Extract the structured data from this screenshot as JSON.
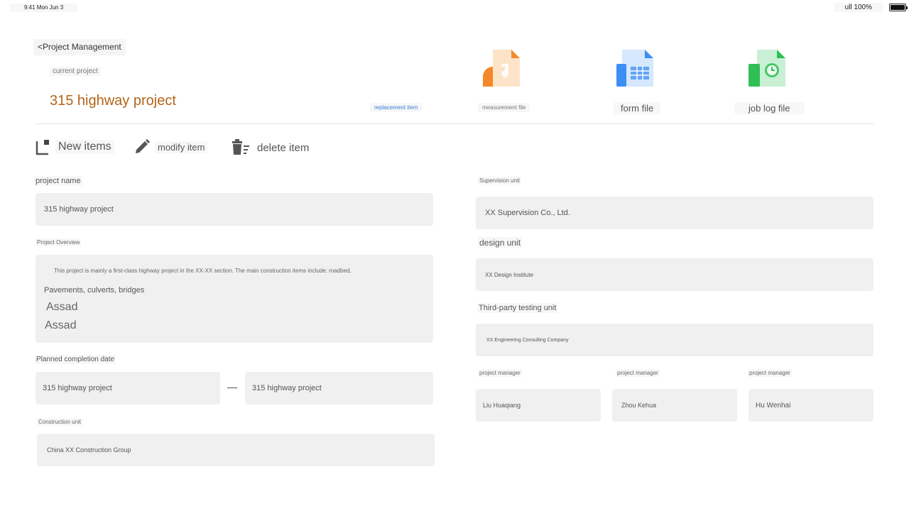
{
  "status_bar": {
    "time": "9:41 Mon Jun 3",
    "battery_text": "ull 100%",
    "battery_level": 1.0
  },
  "header": {
    "back_label": "<Project Management",
    "current_label": "current project",
    "project_title": "315 highway project"
  },
  "files": [
    {
      "label": "replacement item",
      "icon": "none"
    },
    {
      "label": "measurement file",
      "icon": "audio-file-icon",
      "color": "#f5892a"
    },
    {
      "label": "form file",
      "icon": "spreadsheet-file-icon",
      "color": "#3c8ef5"
    },
    {
      "label": "job log file",
      "icon": "clock-file-icon",
      "color": "#2fbf55"
    }
  ],
  "toolbar": {
    "new_label": "New items",
    "modify_label": "modify item",
    "delete_label": "delete item"
  },
  "form": {
    "project_name_label": "project name",
    "project_name_value": "315 highway project",
    "overview_label": "Project Overview",
    "overview_lines": [
      "This project is mainly a first-class highway project in the XX-XX section. The main construction items include: roadbed,",
      "Pavements, culverts, bridges",
      "Assad",
      "Assad"
    ],
    "planned_date_label": "Planned completion date",
    "planned_start_value": "315 highway project",
    "planned_separator": "—",
    "planned_end_value": "315 highway project",
    "construction_unit_label": "Construction unit",
    "construction_unit_value": "China XX Construction Group",
    "supervision_unit_label": "Supervision unit",
    "supervision_unit_value": "XX Supervision Co., Ltd.",
    "design_unit_label": "design unit",
    "design_unit_value": "XX Design Institute",
    "testing_unit_label": "Third-party testing unit",
    "testing_unit_value": "XX Engineering Consulting Company",
    "managers": [
      {
        "label": "project manager",
        "value": "Liu Huaqiang"
      },
      {
        "label": "project manager",
        "value": "Zhou Kehua"
      },
      {
        "label": "project manager",
        "value": "Hu Wenhai"
      }
    ]
  },
  "colors": {
    "title_orange": "#b3651a",
    "link_blue": "#3a7bd5",
    "field_bg": "#f0f0f0"
  }
}
